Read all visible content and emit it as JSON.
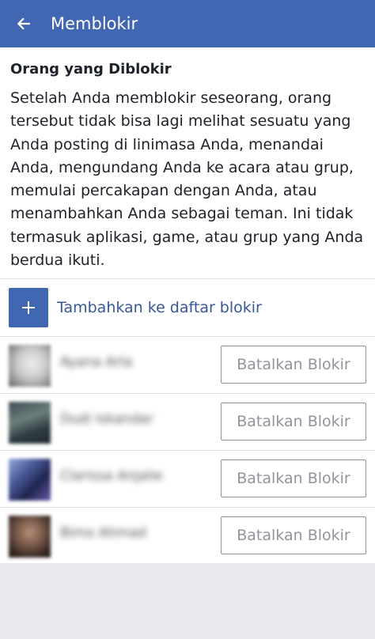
{
  "appbar": {
    "title": "Memblokir",
    "color": "#4267b2"
  },
  "section": {
    "title": "Orang yang Diblokir",
    "description": "Setelah Anda memblokir seseorang, orang tersebut tidak bisa lagi melihat sesuatu yang Anda posting di linimasa Anda, menandai Anda, mengundang Anda ke acara atau grup, memulai percakapan dengan Anda, atau menambahkan Anda sebagai teman. Ini tidak termasuk aplikasi, game, atau grup yang Anda berdua ikuti."
  },
  "add_blocklist": {
    "label": "Tambahkan ke daftar blokir",
    "icon": "plus-icon"
  },
  "blocked_users": [
    {
      "name": "Ayana Arla",
      "button_label": "Batalkan Blokir"
    },
    {
      "name": "Dudi Iskandar",
      "button_label": "Batalkan Blokir"
    },
    {
      "name": "Clarissa Anjalie",
      "button_label": "Batalkan Blokir"
    },
    {
      "name": "Bimo Ahmad",
      "button_label": "Batalkan Blokir"
    }
  ]
}
